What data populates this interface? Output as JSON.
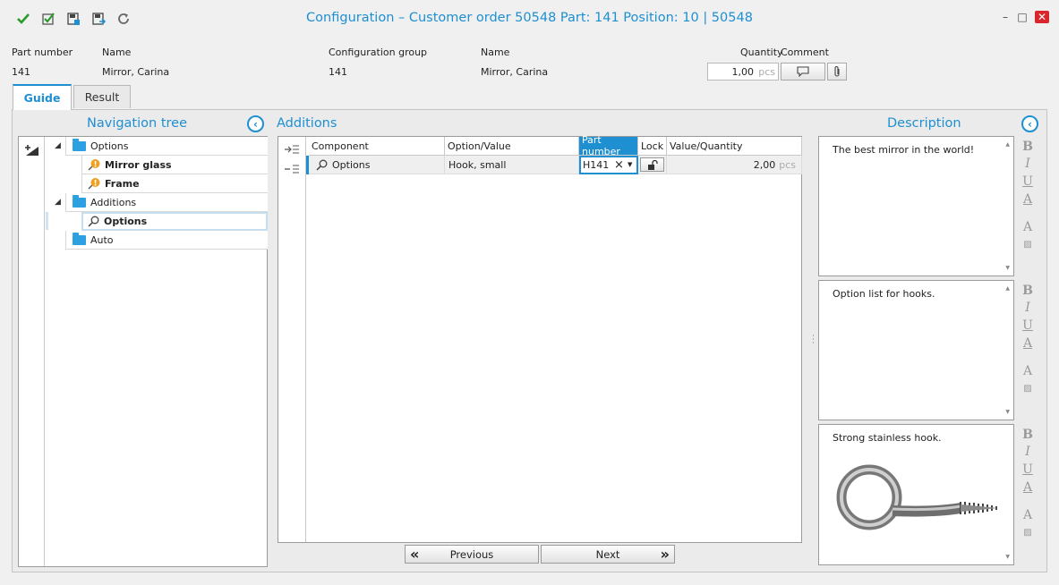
{
  "window": {
    "title": "Configuration – Customer order 50548 Part: 141 Position: 10 | 50548",
    "toolbar_icons": [
      "check-icon",
      "checkbox-icon",
      "save-close-icon",
      "save-next-icon",
      "refresh-icon"
    ],
    "controls": {
      "minimize": "–",
      "maximize": "□",
      "close": "✕"
    }
  },
  "header": {
    "part_number_label": "Part number",
    "part_number_value": "141",
    "name_label": "Name",
    "name_value": "Mirror, Carina",
    "config_group_label": "Configuration group",
    "config_group_value": "141",
    "name2_label": "Name",
    "name2_value": "Mirror, Carina",
    "quantity_label": "Quantity",
    "comment_label": "Comment",
    "quantity_value": "1,00",
    "quantity_unit": "pcs"
  },
  "tabs": [
    {
      "label": "Guide",
      "active": true
    },
    {
      "label": "Result",
      "active": false
    }
  ],
  "navigation": {
    "title": "Navigation tree",
    "items": [
      {
        "label": "Options",
        "type": "folder",
        "expanded": true
      },
      {
        "label": "Mirror glass",
        "type": "warning"
      },
      {
        "label": "Frame",
        "type": "warning"
      },
      {
        "label": "Additions",
        "type": "folder",
        "expanded": true
      },
      {
        "label": "Options",
        "type": "search",
        "selected": true
      },
      {
        "label": "Auto",
        "type": "folder"
      }
    ]
  },
  "additions": {
    "title": "Additions",
    "columns": [
      "Component",
      "Option/Value",
      "Part number",
      "Lock",
      "Value/Quantity"
    ],
    "rows": [
      {
        "component": "Options",
        "option_value": "Hook, small",
        "part_number": "H141",
        "lock": "unlocked",
        "quantity": "2,00",
        "unit": "pcs"
      }
    ],
    "previous_label": "Previous",
    "next_label": "Next"
  },
  "description": {
    "title": "Description",
    "boxes": [
      {
        "text": "The best mirror in the world!"
      },
      {
        "text": "Option list for hooks."
      },
      {
        "text": "Strong stainless hook."
      }
    ],
    "format_buttons": [
      "B",
      "I",
      "U",
      "A",
      "A"
    ]
  },
  "colors": {
    "accent": "#1e8fd1",
    "folder": "#2ca0e0",
    "warning": "#f0a020"
  }
}
